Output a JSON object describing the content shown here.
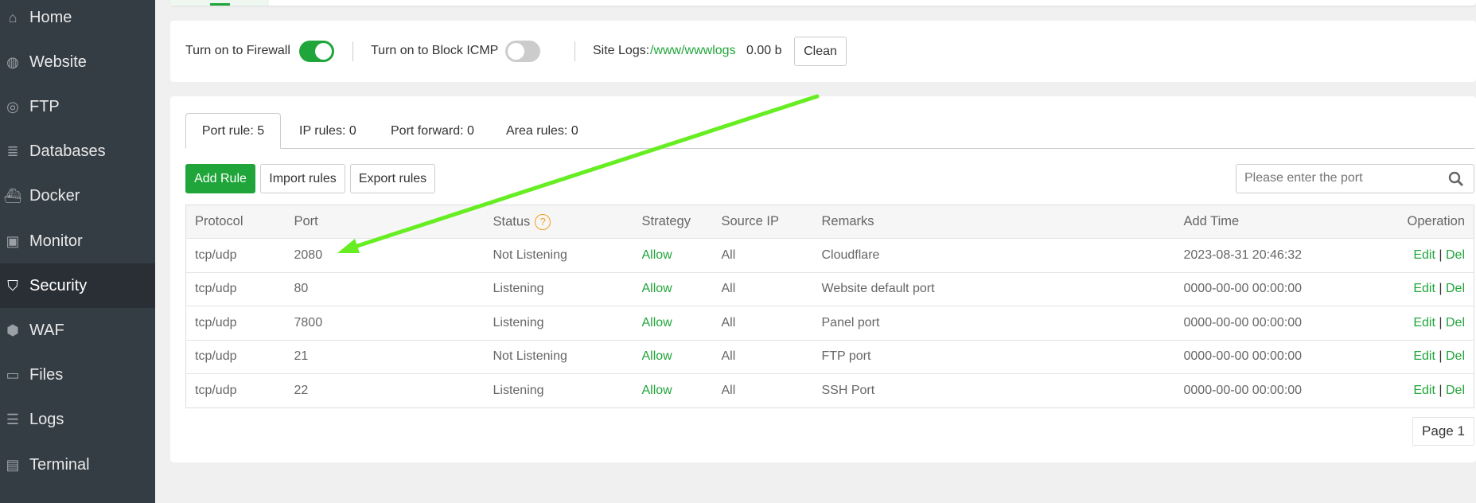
{
  "sidebar": {
    "items": [
      {
        "label": "Home",
        "icon": "home-icon"
      },
      {
        "label": "Website",
        "icon": "globe-icon"
      },
      {
        "label": "FTP",
        "icon": "ftp-icon"
      },
      {
        "label": "Databases",
        "icon": "database-icon"
      },
      {
        "label": "Docker",
        "icon": "docker-icon"
      },
      {
        "label": "Monitor",
        "icon": "monitor-icon"
      },
      {
        "label": "Security",
        "icon": "shield-icon"
      },
      {
        "label": "WAF",
        "icon": "waf-icon"
      },
      {
        "label": "Files",
        "icon": "folder-icon"
      },
      {
        "label": "Logs",
        "icon": "logs-icon"
      },
      {
        "label": "Terminal",
        "icon": "terminal-icon"
      }
    ],
    "active": "Security"
  },
  "firewall": {
    "firewall_label": "Turn on to Firewall",
    "firewall_on": true,
    "icmp_label": "Turn on to Block ICMP",
    "icmp_on": false,
    "site_logs_label": "Site Logs:",
    "site_logs_path": "/www/wwwlogs",
    "site_logs_size": "0.00 b",
    "clean_label": "Clean"
  },
  "tabs": [
    {
      "label": "Port rule: 5"
    },
    {
      "label": "IP rules: 0"
    },
    {
      "label": "Port forward: 0"
    },
    {
      "label": "Area rules: 0"
    }
  ],
  "toolbar": {
    "add": "Add Rule",
    "import": "Import rules",
    "export": "Export rules",
    "search_placeholder": "Please enter the port"
  },
  "table": {
    "headers": {
      "protocol": "Protocol",
      "port": "Port",
      "status": "Status",
      "status_hint": "?",
      "strategy": "Strategy",
      "source": "Source IP",
      "remarks": "Remarks",
      "time": "Add Time",
      "op": "Operation"
    },
    "rows": [
      {
        "protocol": "tcp/udp",
        "port": "2080",
        "status": "Not Listening",
        "strategy": "Allow",
        "source": "All",
        "remarks": "Cloudflare",
        "time": "2023-08-31 20:46:32"
      },
      {
        "protocol": "tcp/udp",
        "port": "80",
        "status": "Listening",
        "strategy": "Allow",
        "source": "All",
        "remarks": "Website default port",
        "time": "0000-00-00 00:00:00"
      },
      {
        "protocol": "tcp/udp",
        "port": "7800",
        "status": "Listening",
        "strategy": "Allow",
        "source": "All",
        "remarks": "Panel port",
        "time": "0000-00-00 00:00:00"
      },
      {
        "protocol": "tcp/udp",
        "port": "21",
        "status": "Not Listening",
        "strategy": "Allow",
        "source": "All",
        "remarks": "FTP port",
        "time": "0000-00-00 00:00:00"
      },
      {
        "protocol": "tcp/udp",
        "port": "22",
        "status": "Listening",
        "strategy": "Allow",
        "source": "All",
        "remarks": "SSH Port",
        "time": "0000-00-00 00:00:00"
      }
    ],
    "edit": "Edit",
    "sep": "|",
    "del": "Del"
  },
  "pagination": {
    "label": "Page 1"
  },
  "colors": {
    "accent": "#20a53a",
    "sidebar": "#353d44",
    "arrow": "#66ee22"
  }
}
